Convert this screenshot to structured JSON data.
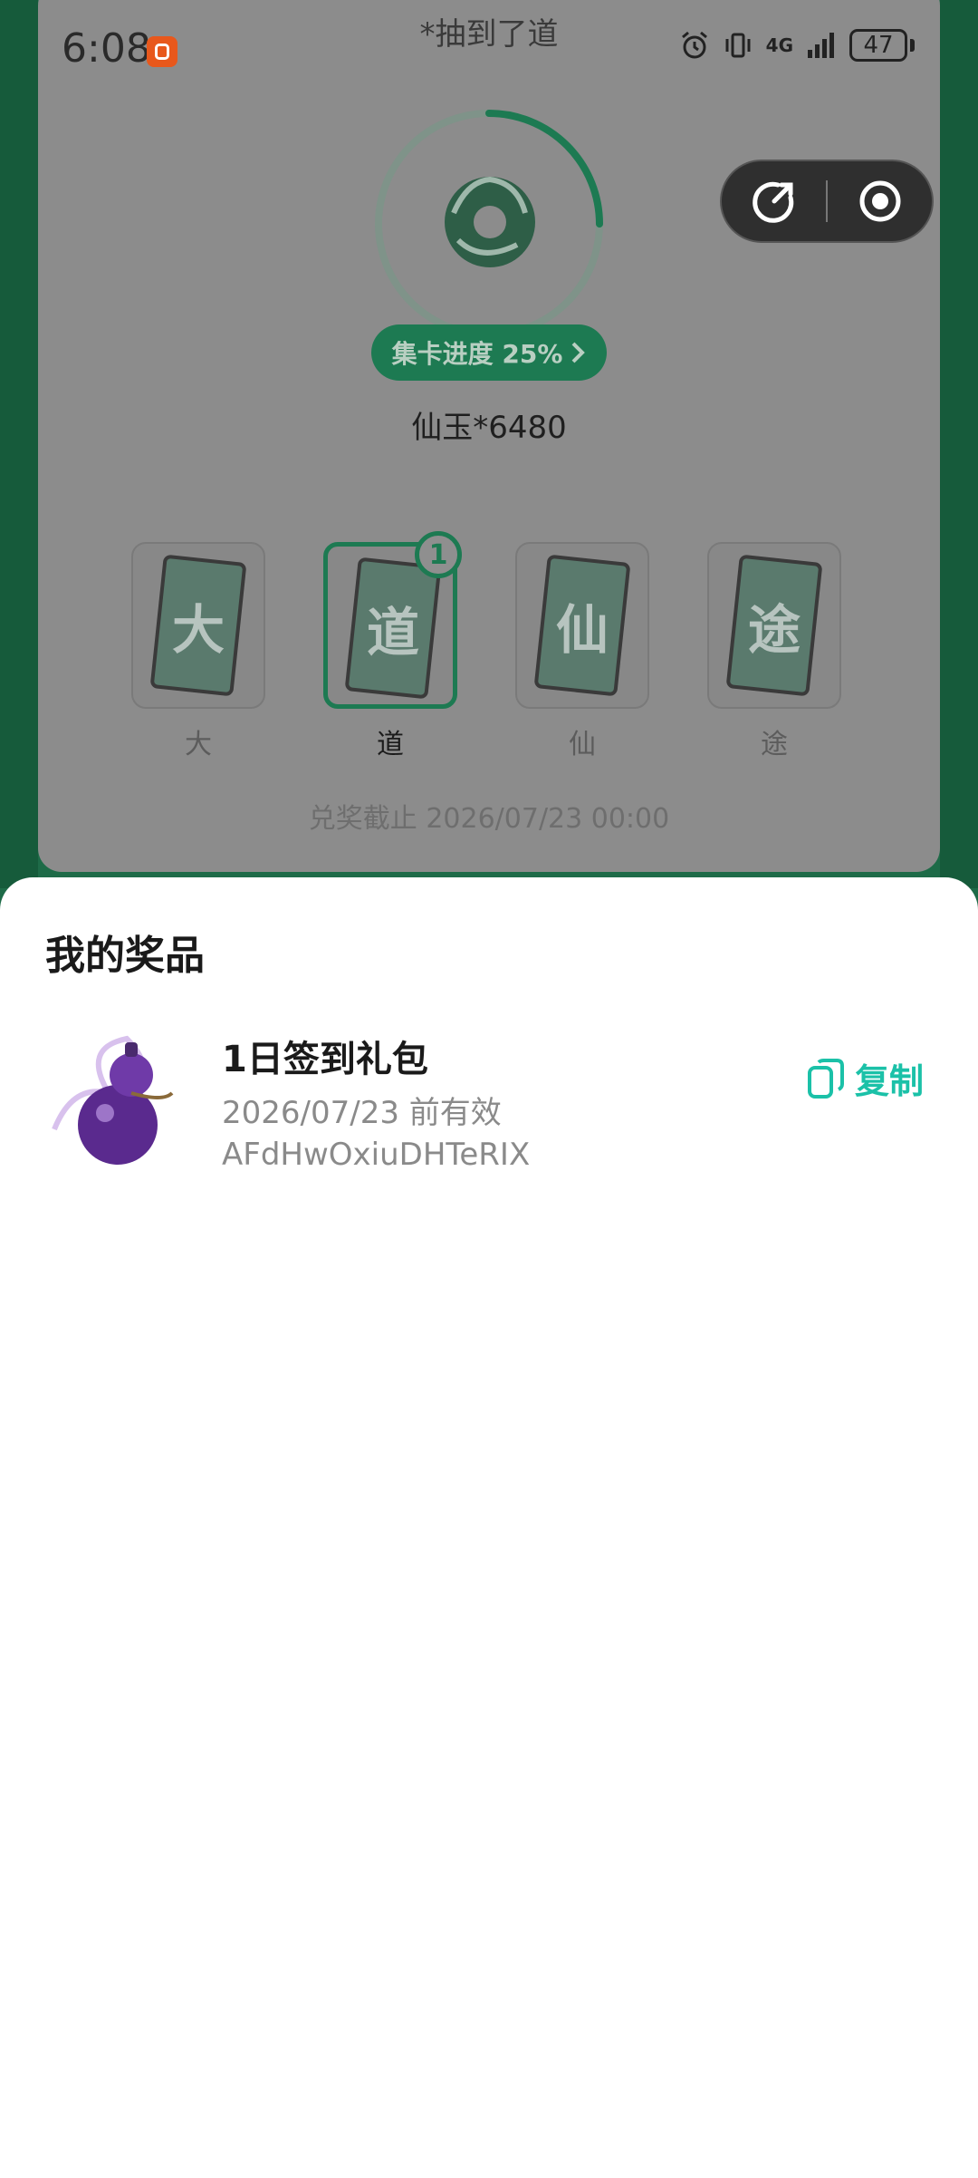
{
  "status_bar": {
    "time": "6:08",
    "network": "4G",
    "battery": "47",
    "icons": [
      "app-badge-icon",
      "alarm-icon",
      "vibrate-icon",
      "signal-icon",
      "battery-icon"
    ]
  },
  "page": {
    "title": "*抽到了道",
    "progress_label": "集卡进度 25%",
    "progress_fraction": 0.25,
    "reward": "仙玉*6480",
    "deadline": "兑奖截止 2026/07/23 00:00",
    "cards": [
      {
        "char": "大",
        "label": "大",
        "selected": false
      },
      {
        "char": "道",
        "label": "道",
        "selected": true,
        "count": "1"
      },
      {
        "char": "仙",
        "label": "仙",
        "selected": false
      },
      {
        "char": "途",
        "label": "途",
        "selected": false
      }
    ]
  },
  "sheet": {
    "title": "我的奖品",
    "prizes": [
      {
        "name": "1日签到礼包",
        "valid": "2026/07/23 前有效",
        "code": "AFdHwOxiuDHTeRIX",
        "copy_label": "复制"
      }
    ]
  },
  "colors": {
    "accent": "#1bc1a8",
    "brand_green": "#1d7a52"
  }
}
